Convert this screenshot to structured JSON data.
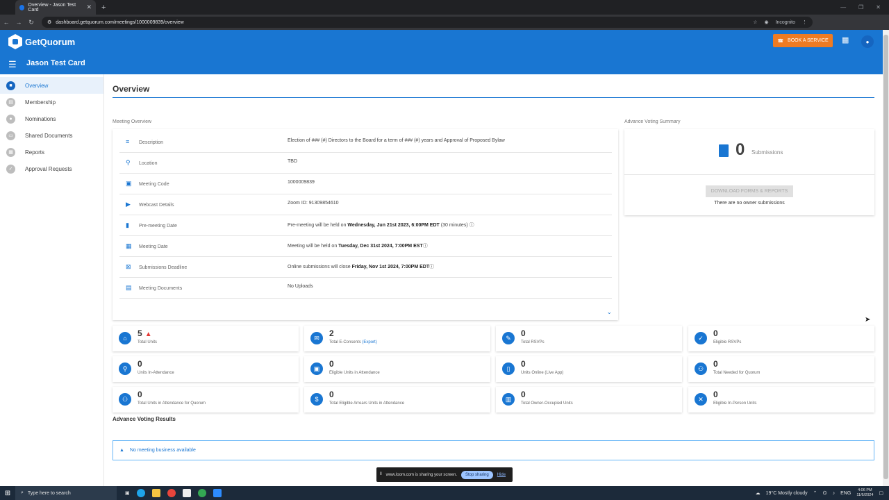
{
  "browser": {
    "tab_title": "Overview - Jason Test Card",
    "url": "dashboard.getquorum.com/meetings/1000009839/overview",
    "incognito_label": "Incognito"
  },
  "appbar": {
    "brand": "GetQuorum",
    "title": "Jason Test Card",
    "book_label": "BOOK A SERVICE"
  },
  "sidebar": {
    "items": [
      {
        "label": "Overview",
        "icon": "overview-icon"
      },
      {
        "label": "Membership",
        "icon": "membership-icon"
      },
      {
        "label": "Nominations",
        "icon": "nominations-icon"
      },
      {
        "label": "Shared Documents",
        "icon": "documents-icon"
      },
      {
        "label": "Reports",
        "icon": "reports-icon"
      },
      {
        "label": "Approval Requests",
        "icon": "approval-icon"
      }
    ]
  },
  "page": {
    "title": "Overview",
    "meeting_overview_label": "Meeting Overview",
    "avs_label": "Advance Voting Summary"
  },
  "overview_rows": [
    {
      "label": "Description",
      "value": "Election of ### (#) Directors to the Board for a term of ### (#) years and Approval of Proposed Bylaw"
    },
    {
      "label": "Location",
      "value": "TBD"
    },
    {
      "label": "Meeting Code",
      "value": "1000009839"
    },
    {
      "label": "Webcast Details",
      "value": "Zoom ID: 91309854610"
    },
    {
      "label": "Pre-meeting Date",
      "pre": "Pre-meeting will be held on ",
      "bold": "Wednesday, Jun 21st 2023, 6:00PM EDT",
      "post": " (30 minutes)"
    },
    {
      "label": "Meeting Date",
      "pre": "Meeting will be held on ",
      "bold": "Tuesday, Dec 31st 2024, 7:00PM EST",
      "post": ""
    },
    {
      "label": "Submissions Deadline",
      "pre": "Online submissions will close ",
      "bold": "Friday, Nov 1st 2024, 7:00PM EDT",
      "post": ""
    },
    {
      "label": "Meeting Documents",
      "value": "No Uploads"
    }
  ],
  "avs": {
    "count": "0",
    "sub": "Submissions",
    "download_label": "DOWNLOAD FORMS & REPORTS",
    "empty": "There are no owner submissions"
  },
  "stats": [
    {
      "value": "5",
      "label": "Total Units"
    },
    {
      "value": "2",
      "label": "Total E-Consents",
      "extra": "(Export)"
    },
    {
      "value": "0",
      "label": "Total RSVPs"
    },
    {
      "value": "0",
      "label": "Eligible RSVPs"
    },
    {
      "value": "0",
      "label": "Units In-Attendance"
    },
    {
      "value": "0",
      "label": "Eligible Units in Attendance"
    },
    {
      "value": "0",
      "label": "Units Online (Live App)"
    },
    {
      "value": "0",
      "label": "Total Needed for Quorum"
    },
    {
      "value": "0",
      "label": "Total Units in Attendance for Quorum"
    },
    {
      "value": "0",
      "label": "Total Eligible Arrears Units in Attendance"
    },
    {
      "value": "0",
      "label": "Total Owner-Occupied Units"
    },
    {
      "value": "0",
      "label": "Eligible In-Person Units"
    }
  ],
  "results": {
    "title": "Advance Voting Results",
    "empty": "No meeting business available"
  },
  "share": {
    "text": "www.loom.com is sharing your screen.",
    "stop": "Stop sharing",
    "hide": "Hide"
  },
  "taskbar": {
    "search": "Type here to search",
    "weather": "19°C  Mostly cloudy",
    "lang": "ENG",
    "time": "4:06 PM",
    "date": "11/6/2024"
  },
  "colors": {
    "primary": "#1976d2",
    "accent": "#ef7b22",
    "warning": "#e53935"
  }
}
